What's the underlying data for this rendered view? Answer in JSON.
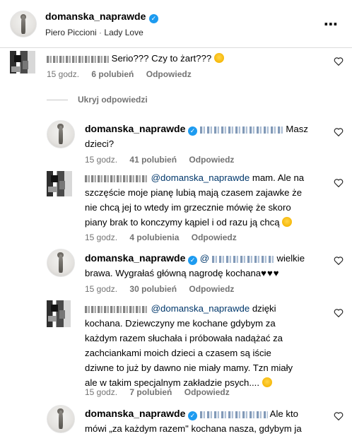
{
  "header": {
    "username": "domanska_naprawde",
    "subtitle_artist": "Piero Piccioni",
    "subtitle_separator": "·",
    "subtitle_song": "Lady Love",
    "more_label": "⋯"
  },
  "hide_replies_label": "Ukryj odpowiedzi",
  "comments": [
    {
      "username": "",
      "text": "Serio??? Czy to żart???",
      "emoji": "thinking-face-emoji",
      "time": "15 godz.",
      "likes": "6 polubień",
      "reply": "Odpowiedz"
    },
    {
      "username": "domanska_naprawde",
      "text_a": "Masz",
      "text_b": "dzieci?",
      "time": "15 godz.",
      "likes": "41 polubień",
      "reply": "Odpowiedz"
    },
    {
      "username": "",
      "mention": "@domanska_naprawde",
      "text_a": " mam. Ale na",
      "text_b": "szczęście moje pianę lubią mają czasem zajawke że",
      "text_c": "nie chcą jej to wtedy im grzecznie mówię że skoro",
      "text_d": "piany brak to konczymy kąpiel i od razu ją chcą",
      "emoji": "grinning-face-emoji",
      "time": "15 godz.",
      "likes": "4 polubienia",
      "reply": "Odpowiedz"
    },
    {
      "username": "domanska_naprawde",
      "mention_prefix": "@",
      "text_a": "wielkie",
      "text_b": "brawa. Wygrałaś główną nagrodę kochana",
      "hearts": "♥♥♥",
      "time": "15 godz.",
      "likes": "30 polubień",
      "reply": "Odpowiedz"
    },
    {
      "username": "",
      "mention": "@domanska_naprawde",
      "text_a": " dzięki",
      "text_b": "kochana. Dziewczyny me kochane gdybym za",
      "text_c": "każdym razem słuchała i próbowała nadążać za",
      "text_d": "zachciankami moich dzieci a czasem są iście",
      "text_e": "dziwne to już by dawno nie miały mamy. Tzn miały",
      "text_f": "ale w takim specjalnym zakładzie psych....",
      "emoji": "laughing-face-emoji",
      "time": "15 godz.",
      "likes": "7 polubień",
      "reply": "Odpowiedz"
    },
    {
      "username": "domanska_naprawde",
      "text_a": "Ale kto",
      "text_b": "mówi „za każdym razem\" kochana nasza, gdybym ja"
    }
  ],
  "colors": {
    "verified": "#1d9bf0",
    "mention": "#00376b",
    "meta": "#737373",
    "divider": "#dbdbdb"
  }
}
